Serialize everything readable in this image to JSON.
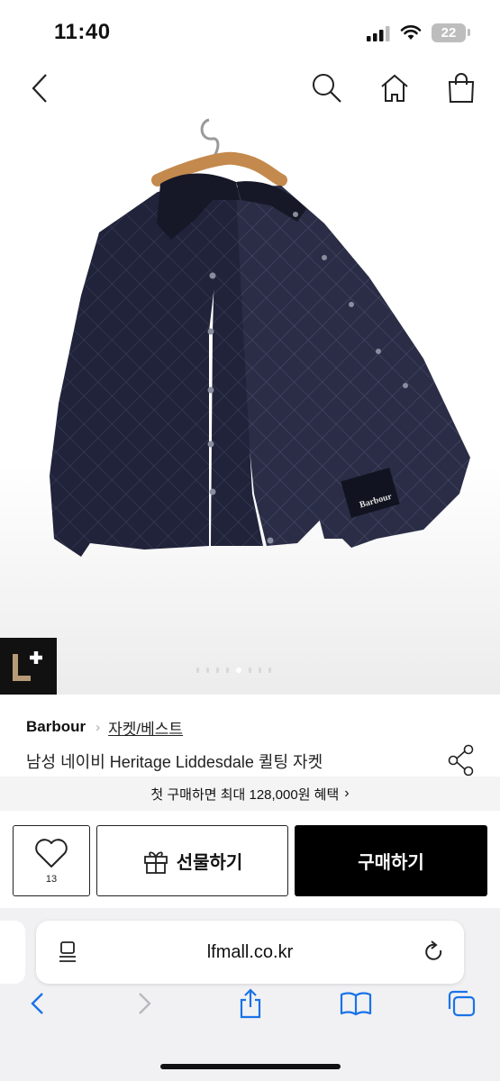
{
  "status_bar": {
    "time": "11:40",
    "battery": "22"
  },
  "nav": {
    "back_icon": "chevron-left-icon",
    "search_icon": "search-icon",
    "home_icon": "home-icon",
    "cart_icon": "shopping-bag-icon"
  },
  "gallery": {
    "badge": "L+",
    "total_slides": 8,
    "active_slide": 7
  },
  "product": {
    "brand": "Barbour",
    "category": "자켓/베스트",
    "name": "남성 네이비 Heritage Liddesdale 퀼팅 자켓",
    "label_text": "Barbour"
  },
  "promo": {
    "text": "첫 구매하면 최대 128,000원 혜택",
    "chevron": "›"
  },
  "actions": {
    "like_count": "13",
    "gift_label": "선물하기",
    "buy_label": "구매하기"
  },
  "browser": {
    "url": "lfmall.co.kr"
  },
  "colors": {
    "jacket": "#1f2233",
    "primary_button": "#000000",
    "promo_bg": "#f4f4f4",
    "link_blue": "#1a73e8"
  }
}
